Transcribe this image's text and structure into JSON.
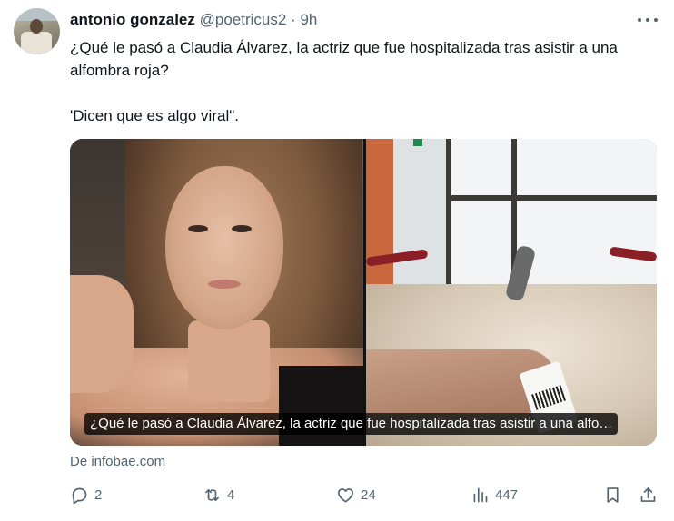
{
  "tweet": {
    "author_name": "antonio gonzalez",
    "handle": "@poetricus2",
    "separator": "·",
    "time": "9h",
    "text_line1": "¿Qué le pasó a Claudia Álvarez, la actriz que fue hospitalizada tras asistir a una alfombra roja?",
    "text_line2": "'Dicen que es algo viral\"."
  },
  "card": {
    "caption": "¿Qué le pasó a Claudia Álvarez, la actriz que fue hospitalizada tras asistir a una alfo…",
    "source": "De infobae.com"
  },
  "actions": {
    "replies": "2",
    "retweets": "4",
    "likes": "24",
    "views": "447"
  },
  "icons": {
    "reply": "reply-icon",
    "retweet": "retweet-icon",
    "like": "heart-icon",
    "views": "views-icon",
    "bookmark": "bookmark-icon",
    "share": "share-icon",
    "more": "more-icon"
  },
  "colors": {
    "text": "#0f1419",
    "secondary": "#536471"
  }
}
